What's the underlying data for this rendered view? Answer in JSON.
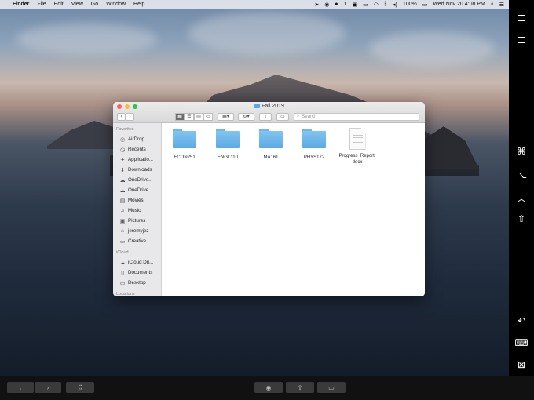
{
  "menubar": {
    "items": [
      "Finder",
      "File",
      "Edit",
      "View",
      "Go",
      "Window",
      "Help"
    ],
    "status": {
      "notification_count": "1",
      "battery": "100%",
      "datetime": "Wed Nov 20  4:08 PM"
    }
  },
  "window": {
    "title": "Fall 2019",
    "search_placeholder": "Search"
  },
  "sidebar": {
    "favorites_header": "Favorites",
    "favorites": [
      {
        "label": "AirDrop",
        "icon": "airdrop-icon"
      },
      {
        "label": "Recents",
        "icon": "clock-icon"
      },
      {
        "label": "Applicatio...",
        "icon": "applications-icon"
      },
      {
        "label": "Downloads",
        "icon": "downloads-icon"
      },
      {
        "label": "OneDrive...",
        "icon": "cloud-icon"
      },
      {
        "label": "OneDrive",
        "icon": "cloud-icon"
      },
      {
        "label": "Movies",
        "icon": "film-icon"
      },
      {
        "label": "Music",
        "icon": "music-icon"
      },
      {
        "label": "Pictures",
        "icon": "camera-icon"
      },
      {
        "label": "jeremyjez",
        "icon": "home-icon"
      },
      {
        "label": "Creative...",
        "icon": "folder-icon"
      }
    ],
    "icloud_header": "iCloud",
    "icloud": [
      {
        "label": "iCloud Dri...",
        "icon": "icloud-icon"
      },
      {
        "label": "Documents",
        "icon": "document-icon"
      },
      {
        "label": "Desktop",
        "icon": "desktop-icon"
      }
    ],
    "locations_header": "Locations"
  },
  "files": [
    {
      "name": "ECON251",
      "type": "folder"
    },
    {
      "name": "ENGL110",
      "type": "folder"
    },
    {
      "name": "MA161",
      "type": "folder"
    },
    {
      "name": "PHYS172",
      "type": "folder"
    },
    {
      "name": "Progress_Report.\ndocx",
      "type": "document"
    }
  ],
  "colors": {
    "folder": "#5aaae3",
    "close": "#fe5f57",
    "minimize": "#febc2e",
    "maximize": "#28c840"
  }
}
